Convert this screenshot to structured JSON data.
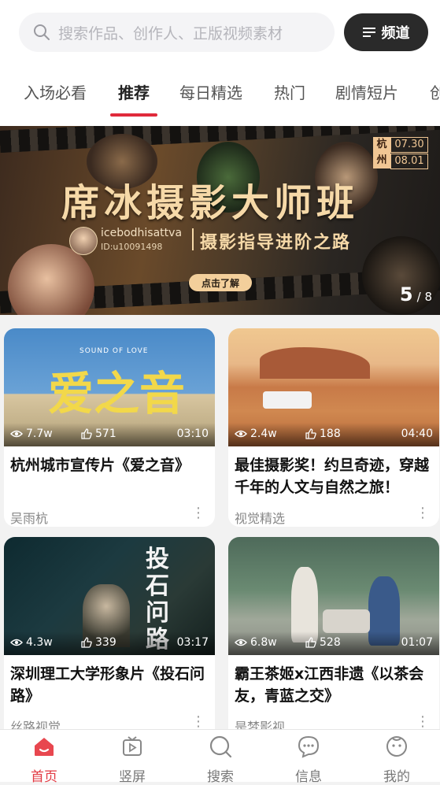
{
  "search": {
    "placeholder": "搜索作品、创作人、正版视频素材"
  },
  "channel_button": {
    "label": "频道"
  },
  "tabs": [
    {
      "label": "入场必看"
    },
    {
      "label": "推荐"
    },
    {
      "label": "每日精选"
    },
    {
      "label": "热门"
    },
    {
      "label": "剧情短片"
    },
    {
      "label": "创"
    }
  ],
  "banner": {
    "title": "席冰摄影大师班",
    "subtitle": "摄影指导进阶之路",
    "handle": "icebodhisattva",
    "handle_id": "ID:u10091498",
    "cta": "点击了解",
    "city": "杭州",
    "date_start": "07.30",
    "date_end": "08.01",
    "page_current": "5",
    "page_total": "/ 8"
  },
  "cards": [
    {
      "title": "杭州城市宣传片《爱之音》",
      "author": "吴雨杭",
      "views": "7.7w",
      "likes": "571",
      "duration": "03:10",
      "overlay_title": "爱之音",
      "overlay_small": "SOUND OF LOVE"
    },
    {
      "title": "最佳摄影奖！约旦奇迹，穿越千年的人文与自然之旅！",
      "author": "视觉精选",
      "views": "2.4w",
      "likes": "188",
      "duration": "04:40"
    },
    {
      "title": "深圳理工大学形象片《投石问路》",
      "author": "丝路视觉",
      "views": "4.3w",
      "likes": "339",
      "duration": "03:17",
      "overlay_title": "投石问路"
    },
    {
      "title": "霸王茶姬x江西非遗《以茶会友，青蓝之交》",
      "author": "是梦影视...",
      "views": "6.8w",
      "likes": "528",
      "duration": "01:07"
    }
  ],
  "more_glyph": "⋮",
  "nav": [
    {
      "label": "首页",
      "icon": "home-icon",
      "active": true
    },
    {
      "label": "竖屏",
      "icon": "vertical-video-icon"
    },
    {
      "label": "搜索",
      "icon": "search-icon"
    },
    {
      "label": "信息",
      "icon": "message-icon"
    },
    {
      "label": "我的",
      "icon": "profile-icon"
    }
  ],
  "colors": {
    "accent": "#e02a3b",
    "banner_gold": "#f6d9a8"
  }
}
